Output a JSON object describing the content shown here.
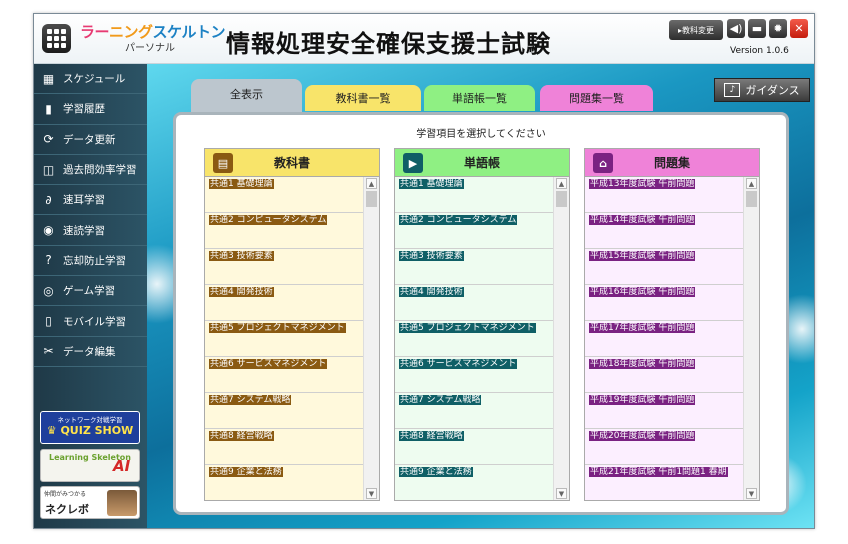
{
  "titlebar": {
    "logo_part1": "ラー",
    "logo_part2": "ニング",
    "logo_part3": "スケルトン",
    "logo_sub": "パーソナル",
    "app_title": "情報処理安全確保支援士試験",
    "subject_change": "▸教科変更",
    "version": "Version 1.0.6"
  },
  "sidebar": {
    "items": [
      {
        "label": "スケジュール",
        "icon": "calendar-icon"
      },
      {
        "label": "学習履歴",
        "icon": "bar-chart-icon"
      },
      {
        "label": "データ更新",
        "icon": "refresh-icon"
      },
      {
        "label": "過去問効率学習",
        "icon": "search-doc-icon"
      },
      {
        "label": "速耳学習",
        "icon": "ear-icon"
      },
      {
        "label": "速読学習",
        "icon": "eye-icon"
      },
      {
        "label": "忘却防止学習",
        "icon": "question-icon"
      },
      {
        "label": "ゲーム学習",
        "icon": "gamepad-icon"
      },
      {
        "label": "モバイル学習",
        "icon": "mobile-icon"
      },
      {
        "label": "データ編集",
        "icon": "scissors-icon"
      }
    ],
    "badges": {
      "quiz_top": "ネットワーク対戦学習",
      "quiz_main": "QUIZ SHOW",
      "ai_left": "Learning Skeleton",
      "ai_right": "AI",
      "neku_top": "仲間がみつかる",
      "neku_main": "ネクレボ"
    }
  },
  "tabs": [
    "全表示",
    "教科書一覧",
    "単語帳一覧",
    "問題集一覧"
  ],
  "guidance": "ガイダンス",
  "panel_title": "学習項目を選択してください",
  "colors": {
    "textbook_bg": "#fff9dc",
    "textbook_hl": "#8a5a12",
    "textbook_head": "#f8e46a",
    "word_bg": "#eefcf0",
    "word_hl": "#0f5f66",
    "word_head": "#8ff083",
    "problem_bg": "#fcefff",
    "problem_hl": "#7a2282",
    "problem_head": "#ef82d8"
  },
  "columns": {
    "textbook": {
      "title": "教科書",
      "items": [
        "共通1 基礎理論",
        "共通2 コンピュータシステム",
        "共通3 技術要素",
        "共通4 開発技術",
        "共通5 プロジェクトマネジメント",
        "共通6 サービスマネジメント",
        "共通7 システム戦略",
        "共通8 経営戦略",
        "共通9 企業と法務"
      ]
    },
    "word": {
      "title": "単語帳",
      "items": [
        "共通1 基礎理論",
        "共通2 コンピュータシステム",
        "共通3 技術要素",
        "共通4 開発技術",
        "共通5 プロジェクトマネジメント",
        "共通6 サービスマネジメント",
        "共通7 システム戦略",
        "共通8 経営戦略",
        "共通9 企業と法務"
      ]
    },
    "problem": {
      "title": "問題集",
      "items": [
        "平成13年度試験 午前問題",
        "平成14年度試験 午前問題",
        "平成15年度試験 午前問題",
        "平成16年度試験 午前問題",
        "平成17年度試験 午前問題",
        "平成18年度試験 午前問題",
        "平成19年度試験 午前問題",
        "平成20年度試験 午前問題",
        "平成21年度試験 午前1問題1 春期"
      ]
    }
  }
}
